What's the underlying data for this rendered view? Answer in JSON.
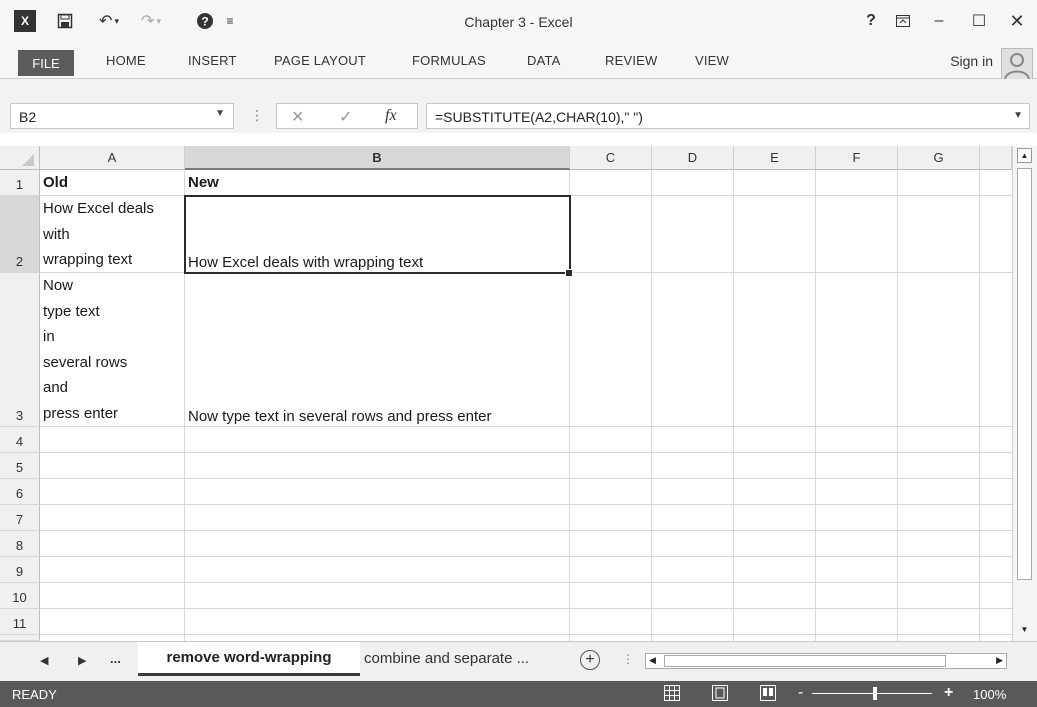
{
  "app": {
    "title": "Chapter 3 - Excel",
    "excel_logo": "X",
    "save_icon": "save-icon",
    "undo_icon": "undo-icon",
    "redo_icon": "redo-icon",
    "help_symbol": "?",
    "window_controls": [
      "?",
      "restore-ribbon",
      "minimize",
      "maximize",
      "close"
    ]
  },
  "ribbon": {
    "tabs": [
      "FILE",
      "HOME",
      "INSERT",
      "PAGE LAYOUT",
      "FORMULAS",
      "DATA",
      "REVIEW",
      "VIEW"
    ],
    "signin": "Sign in"
  },
  "formula_bar": {
    "name_box": "B2",
    "cancel": "✕",
    "enter": "✓",
    "fx": "fx",
    "formula": "=SUBSTITUTE(A2,CHAR(10),\" \")"
  },
  "grid": {
    "columns": [
      "A",
      "B",
      "C",
      "D",
      "E",
      "F",
      "G"
    ],
    "rows": [
      "1",
      "2",
      "3",
      "4",
      "5",
      "6",
      "7",
      "8",
      "9",
      "10",
      "11"
    ],
    "selected_column": "B",
    "selected_row": "2",
    "cells": {
      "A1": "Old",
      "B1": "New",
      "A2": "How Excel deals\nwith\nwrapping text",
      "B2": "How Excel deals with wrapping text",
      "A3": "Now\ntype text\nin\nseveral rows\nand\npress enter",
      "B3": "Now type text in several rows and press enter"
    }
  },
  "sheets": {
    "nav_more": "...",
    "active": "remove word-wrapping",
    "other": "combine and separate ...",
    "add": "+"
  },
  "status": {
    "text": "READY",
    "zoom": "100%",
    "zoom_minus": "-",
    "zoom_plus": "+"
  }
}
